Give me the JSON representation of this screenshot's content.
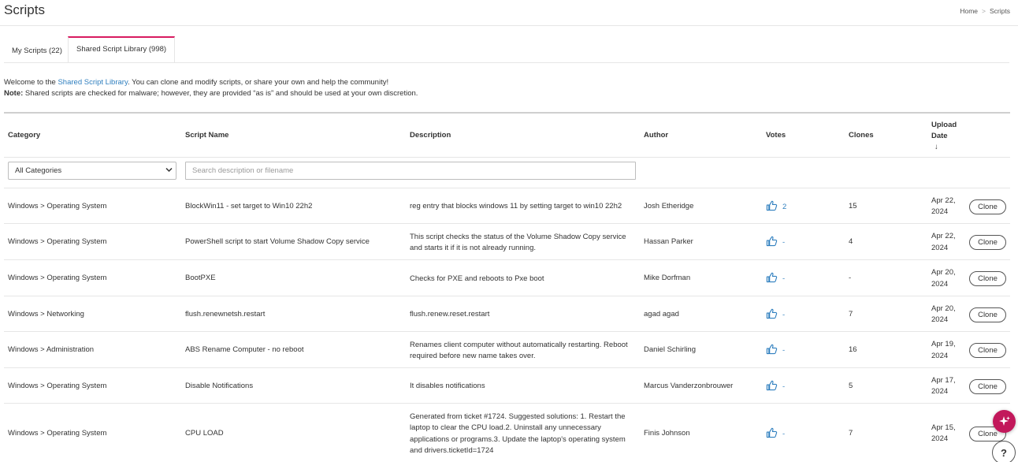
{
  "header": {
    "title": "Scripts",
    "breadcrumb": {
      "home": "Home",
      "separator": ">",
      "current": "Scripts"
    }
  },
  "tabs": [
    {
      "label": "My Scripts (22)",
      "active": false
    },
    {
      "label": "Shared Script Library (998)",
      "active": true
    }
  ],
  "intro": {
    "line1_before": "Welcome to the ",
    "line1_link": "Shared Script Library",
    "line1_after": ". You can clone and modify scripts, or share your own and help the community!",
    "note_label": "Note:",
    "note_text": " Shared scripts are checked for malware; however, they are provided “as is” and should be used at your own discretion."
  },
  "table": {
    "columns": {
      "category": "Category",
      "script_name": "Script Name",
      "description": "Description",
      "author": "Author",
      "votes": "Votes",
      "clones": "Clones",
      "upload_date_line1": "Upload",
      "upload_date_line2": "Date",
      "sort_icon": "↓"
    },
    "filters": {
      "category_selected": "All Categories",
      "search_placeholder": "Search description or filename"
    },
    "clone_label": "Clone",
    "rows": [
      {
        "category": "Windows > Operating System",
        "name": "BlockWin11 - set target to Win10 22h2",
        "description": "reg entry that blocks windows 11 by setting target to win10 22h2",
        "author": "Josh Etheridge",
        "votes": "2",
        "clones": "15",
        "date1": "Apr 22,",
        "date2": "2024"
      },
      {
        "category": "Windows > Operating System",
        "name": "PowerShell script to start Volume Shadow Copy service",
        "description": "This script checks the status of the Volume Shadow Copy service and starts it if it is not already running.",
        "author": "Hassan Parker",
        "votes": "-",
        "clones": "4",
        "date1": "Apr 22,",
        "date2": "2024"
      },
      {
        "category": "Windows > Operating System",
        "name": "BootPXE",
        "description": "Checks for PXE and reboots to Pxe boot",
        "author": "Mike Dorfman",
        "votes": "-",
        "clones": "-",
        "date1": "Apr 20,",
        "date2": "2024"
      },
      {
        "category": "Windows > Networking",
        "name": "flush.renewnetsh.restart",
        "description": "flush.renew.reset.restart",
        "author": "agad agad",
        "votes": "-",
        "clones": "7",
        "date1": "Apr 20,",
        "date2": "2024"
      },
      {
        "category": "Windows > Administration",
        "name": "ABS Rename Computer - no reboot",
        "description": "Renames client computer without automatically restarting. Reboot required before new name takes over.",
        "author": "Daniel Schirling",
        "votes": "-",
        "clones": "16",
        "date1": "Apr 19,",
        "date2": "2024"
      },
      {
        "category": "Windows > Operating System",
        "name": "Disable Notifications",
        "description": "It disables notifications",
        "author": "Marcus Vanderzonbrouwer",
        "votes": "-",
        "clones": "5",
        "date1": "Apr 17,",
        "date2": "2024"
      },
      {
        "category": "Windows > Operating System",
        "name": "CPU LOAD",
        "description": "Generated from ticket #1724. Suggested solutions: 1. Restart the laptop to clear the CPU load.2. Uninstall any unnecessary applications or programs.3. Update the laptop's operating system and drivers.ticketId=1724",
        "author": "Finis Johnson",
        "votes": "-",
        "clones": "7",
        "date1": "Apr 15,",
        "date2": "2024"
      }
    ]
  },
  "floating": {
    "help_label": "?"
  },
  "icons": {
    "thumb": "thumbs-up-icon",
    "sparkle": "sparkle-icon",
    "chevron": "chevron-down-icon"
  },
  "colors": {
    "accent": "#d81b60",
    "link": "#2f7fbf",
    "fab": "#c2185b"
  }
}
